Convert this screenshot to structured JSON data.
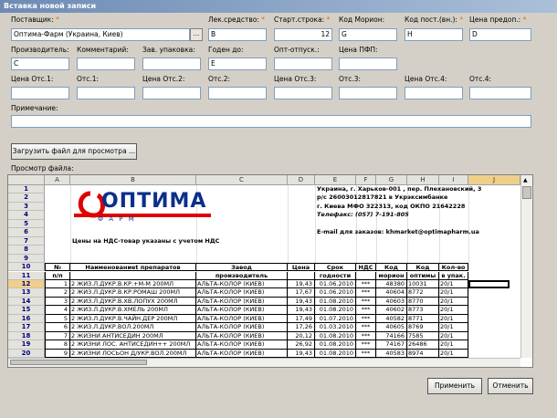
{
  "window": {
    "title": "Вставка новой записи"
  },
  "form": {
    "supplier": {
      "label": "Поставщик:",
      "value": "Оптима-Фарм (Украина, Киев)",
      "lookup": "..."
    },
    "drug": {
      "label": "Лек.средство:",
      "value": "B"
    },
    "start_row": {
      "label": "Старт.строка:",
      "value": "12"
    },
    "morion_code": {
      "label": "Код Морион:",
      "value": "G"
    },
    "supplier_code": {
      "label": "Код пост.(вн.):",
      "value": "H"
    },
    "prev_price": {
      "label": "Цена предоп.:",
      "value": "D"
    },
    "manufacturer": {
      "label": "Производитель:",
      "value": "C"
    },
    "comment": {
      "label": "Комментарий:",
      "value": ""
    },
    "factory_pack": {
      "label": "Зав. упаковка:",
      "value": ""
    },
    "valid_until": {
      "label": "Годен до:",
      "value": "E"
    },
    "wholesale_release": {
      "label": "Опт-отпуск.:",
      "value": ""
    },
    "pfp_price": {
      "label": "Цена ПФП:",
      "value": ""
    },
    "price_otc1": {
      "label": "Цена Отс.1:",
      "value": ""
    },
    "otc1": {
      "label": "Отс.1:",
      "value": ""
    },
    "price_otc2": {
      "label": "Цена Отс.2:",
      "value": ""
    },
    "otc2": {
      "label": "Отс.2:",
      "value": ""
    },
    "price_otc3": {
      "label": "Цена Отс.3:",
      "value": ""
    },
    "otc3": {
      "label": "Отс.3:",
      "value": ""
    },
    "price_otc4": {
      "label": "Цена Отс.4:",
      "value": ""
    },
    "otc4": {
      "label": "Отс.4:",
      "value": ""
    },
    "note": {
      "label": "Примечание:",
      "value": ""
    },
    "required_mark": "*"
  },
  "load_button": "Загрузить файл для просмотра ...",
  "preview_label": "Просмотр файла:",
  "sheet": {
    "columns": [
      "A",
      "B",
      "C",
      "D",
      "E",
      "F",
      "G",
      "H",
      "I",
      "J"
    ],
    "row_numbers": [
      "1",
      "2",
      "3",
      "4",
      "5",
      "6",
      "7",
      "8",
      "9",
      "10",
      "11",
      "12",
      "13",
      "14",
      "15",
      "16",
      "17",
      "18",
      "19",
      "20"
    ],
    "logo_text": "ОПТИМА",
    "logo_sub": "Ф А Р М",
    "company_lines": [
      "Украина, г. Харьков-001 , пер. Плехановский, 3",
      "р/с 26003012817821 в Укрэксимбанке",
      "г. Киева МФО 322313, код ОКПО 21642228",
      "Телефакс: (057)  7-191-805",
      "E-mail для заказов: khmarket@optimapharm.ua"
    ],
    "vat_note": "Цены на НДС-товар указаны с учетом НДС",
    "headers_row10": [
      "№",
      "Наименованиеt препаратов",
      "Завод",
      "Цена",
      "Срок",
      "НДС",
      "Код",
      "Код",
      "Кол-во"
    ],
    "headers_row11": [
      "п/п",
      "",
      "производитель",
      "",
      "годности",
      "",
      "морион",
      "оптимы",
      "в упак."
    ],
    "rows": [
      {
        "n": "1",
        "name": "2 ЖИЗ.Л.ДУКР.В.КР.+М-М 200МЛ",
        "maker": "АЛЬТА-КОЛОР (КИЕВ)",
        "price": "19,43",
        "date": "01.06.2010",
        "vat": "***",
        "morion": "48380",
        "code": "10031",
        "qty": "20/1"
      },
      {
        "n": "2",
        "name": "2 ЖИЗ.Л.ДУКР.В.КР.РОМАШ 200МЛ",
        "maker": "АЛЬТА-КОЛОР (КИЕВ)",
        "price": "17,67",
        "date": "01.06.2010",
        "vat": "***",
        "morion": "40604",
        "code": "8772",
        "qty": "20/1"
      },
      {
        "n": "3",
        "name": "2 ЖИЗ.Л.ДУКР.В.ХВ.ЛОПУХ 200МЛ",
        "maker": "АЛЬТА-КОЛОР (КИЕВ)",
        "price": "19,43",
        "date": "01.08.2010",
        "vat": "***",
        "morion": "40603",
        "code": "8770",
        "qty": "20/1"
      },
      {
        "n": "4",
        "name": "2 ЖИЗ.Л.ДУКР.В.ХМЕЛЬ 200МЛ",
        "maker": "АЛЬТА-КОЛОР (КИЕВ)",
        "price": "19,43",
        "date": "01.08.2010",
        "vat": "***",
        "morion": "40602",
        "code": "8773",
        "qty": "20/1"
      },
      {
        "n": "5",
        "name": "2 ЖИЗ.Л.ДУКР.В.ЧАЙН.ДЕР 200МЛ",
        "maker": "АЛЬТА-КОЛОР (КИЕВ)",
        "price": "17,49",
        "date": "01.07.2010",
        "vat": "***",
        "morion": "40582",
        "code": "8771",
        "qty": "20/1"
      },
      {
        "n": "6",
        "name": "2 ЖИЗ.Л.ДУКР.ВОЛ.200МЛ",
        "maker": "АЛЬТА-КОЛОР (КИЕВ)",
        "price": "17,26",
        "date": "01.03.2010",
        "vat": "***",
        "morion": "40605",
        "code": "8769",
        "qty": "20/1"
      },
      {
        "n": "7",
        "name": "2 ЖИЗНИ АНТИСЕДИН 200МЛ",
        "maker": "АЛЬТА-КОЛОР (КИЕВ)",
        "price": "20,12",
        "date": "01.08.2010",
        "vat": "***",
        "morion": "74166",
        "code": "7585",
        "qty": "20/1"
      },
      {
        "n": "8",
        "name": "2 ЖИЗНИ ЛОС. АНТИСЕДИН++ 200МЛ",
        "maker": "АЛЬТА-КОЛОР (КИЕВ)",
        "price": "26,92",
        "date": "01.08.2010",
        "vat": "***",
        "morion": "74167",
        "code": "26486",
        "qty": "20/1"
      },
      {
        "n": "9",
        "name": "2 ЖИЗНИ ЛОСЬОН Д/УКР.ВОЛ.200МЛ",
        "maker": "АЛЬТА-КОЛОР (КИЕВ)",
        "price": "19,43",
        "date": "01.08.2010",
        "vat": "***",
        "morion": "40583",
        "code": "8974",
        "qty": "20/1"
      }
    ]
  },
  "buttons": {
    "apply": "Применить",
    "cancel": "Отменить"
  }
}
